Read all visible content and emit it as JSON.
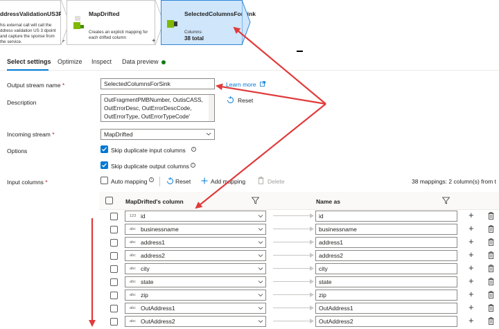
{
  "pipeline": {
    "nodes": [
      {
        "title": "ddressValidationUS3R...",
        "description": "his external call will call the ddress validation US 3 dpoint and capture the sponse from the service."
      },
      {
        "title": "MapDrifted",
        "description": "Creates an explicit mapping for each drifted column"
      },
      {
        "title": "SelectedColumnsForSink",
        "description": "Columns:",
        "count": "38 total"
      }
    ],
    "plus": "+"
  },
  "tabs": [
    {
      "label": "Select settings"
    },
    {
      "label": "Optimize"
    },
    {
      "label": "Inspect"
    },
    {
      "label": "Data preview"
    }
  ],
  "form": {
    "output_stream_label": "Output stream name",
    "required_mark": "*",
    "output_stream_value": "SelectedColumnsForSink",
    "learn_more": "Learn more",
    "description_label": "Description",
    "description_lines": [
      "OutFragmentPMBNumber, OutisCASS,",
      "OutErrorDesc, OutErrorDescCode,",
      "OutErrorType, OutErrorTypeCode'"
    ],
    "reset_label": "Reset",
    "incoming_stream_label": "Incoming stream",
    "incoming_stream_value": "MapDrifted",
    "options_label": "Options",
    "skip_input": "Skip duplicate input columns",
    "skip_output": "Skip duplicate output columns",
    "input_columns_label": "Input columns",
    "auto_mapping": "Auto mapping",
    "toolbar_reset": "Reset",
    "add_mapping": "Add mapping",
    "delete": "Delete",
    "mapping_summary": "38 mappings: 2 column(s) from t"
  },
  "grid": {
    "col_source": "MapDrifted's column",
    "col_name": "Name as",
    "rows": [
      {
        "type": "123",
        "column": "id",
        "name_as": "id"
      },
      {
        "type": "abc",
        "column": "businessname",
        "name_as": "businessname"
      },
      {
        "type": "abc",
        "column": "address1",
        "name_as": "address1"
      },
      {
        "type": "abc",
        "column": "address2",
        "name_as": "address2"
      },
      {
        "type": "abc",
        "column": "city",
        "name_as": "city"
      },
      {
        "type": "abc",
        "column": "state",
        "name_as": "state"
      },
      {
        "type": "abc",
        "column": "zip",
        "name_as": "zip"
      },
      {
        "type": "abc",
        "column": "OutAddress1",
        "name_as": "OutAddress1"
      },
      {
        "type": "abc",
        "column": "OutAddress2",
        "name_as": "OutAddress2"
      }
    ]
  },
  "colors": {
    "accent": "#0078d4",
    "selected_node": "#cfe6fb",
    "annotation": "#e03a3a",
    "status_ok": "#107c10"
  }
}
